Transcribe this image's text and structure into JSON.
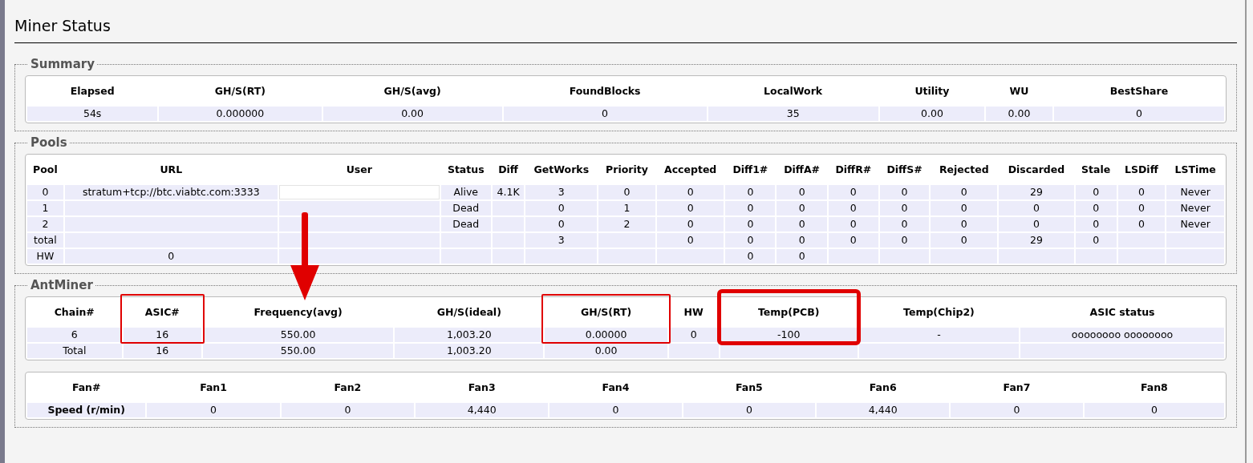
{
  "page": {
    "title": "Miner Status"
  },
  "sections": [
    {
      "legend": "Summary",
      "tables": [
        {
          "kind": "summary",
          "columns": [
            {
              "label": "Elapsed"
            },
            {
              "label": "GH/S(RT)"
            },
            {
              "label": "GH/S(avg)"
            },
            {
              "label": "FoundBlocks"
            },
            {
              "label": "LocalWork"
            },
            {
              "label": "Utility"
            },
            {
              "label": "WU"
            },
            {
              "label": "BestShare"
            }
          ],
          "rows": [
            {
              "cells": [
                "54s",
                "0.000000",
                "0.00",
                "0",
                "35",
                "0.00",
                "0.00",
                "0"
              ]
            }
          ]
        }
      ]
    },
    {
      "legend": "Pools",
      "tables": [
        {
          "kind": "pools",
          "columns": [
            {
              "label": "Pool"
            },
            {
              "label": "URL"
            },
            {
              "label": "User"
            },
            {
              "label": "Status"
            },
            {
              "label": "Diff"
            },
            {
              "label": "GetWorks"
            },
            {
              "label": "Priority"
            },
            {
              "label": "Accepted"
            },
            {
              "label": "Diff1#"
            },
            {
              "label": "DiffA#"
            },
            {
              "label": "DiffR#"
            },
            {
              "label": "DiffS#"
            },
            {
              "label": "Rejected"
            },
            {
              "label": "Discarded"
            },
            {
              "label": "Stale"
            },
            {
              "label": "LSDiff"
            },
            {
              "label": "LSTime"
            }
          ],
          "rows": [
            {
              "cells": [
                "0",
                "stratum+tcp://btc.viabtc.com:3333",
                {
                  "kind": "redacted"
                },
                "Alive",
                "4.1K",
                "3",
                "0",
                "0",
                "0",
                "0",
                "0",
                "0",
                "0",
                "29",
                "0",
                "0",
                "Never"
              ]
            },
            {
              "cells": [
                "1",
                null,
                null,
                "Dead",
                null,
                "0",
                "1",
                "0",
                "0",
                "0",
                "0",
                "0",
                "0",
                "0",
                "0",
                "0",
                "Never"
              ]
            },
            {
              "cells": [
                "2",
                null,
                null,
                "Dead",
                null,
                "0",
                "2",
                "0",
                "0",
                "0",
                "0",
                "0",
                "0",
                "0",
                "0",
                "0",
                "Never"
              ]
            },
            {
              "cells": [
                "total",
                null,
                null,
                null,
                null,
                "3",
                null,
                "0",
                "0",
                "0",
                "0",
                "0",
                "0",
                "29",
                "0",
                null,
                null
              ]
            },
            {
              "cells": [
                "HW",
                "0",
                null,
                null,
                null,
                null,
                null,
                null,
                "0",
                "0",
                null,
                null,
                null,
                null,
                null,
                null,
                null
              ]
            }
          ]
        }
      ]
    },
    {
      "legend": "AntMiner",
      "tables": [
        {
          "kind": "chains",
          "columns": [
            {
              "label": "Chain#",
              "boxed": false,
              "arrow": false
            },
            {
              "label": "ASIC#",
              "boxed": true,
              "thick": false,
              "arrow": false
            },
            {
              "label": "Frequency(avg)",
              "boxed": false,
              "arrow": true
            },
            {
              "label": "GH/S(ideal)",
              "boxed": false,
              "arrow": false
            },
            {
              "label": "GH/S(RT)",
              "boxed": true,
              "thick": false,
              "arrow": false
            },
            {
              "label": "HW",
              "boxed": false,
              "arrow": false
            },
            {
              "label": "Temp(PCB)",
              "boxed": true,
              "thick": true,
              "arrow": false
            },
            {
              "label": "Temp(Chip2)",
              "boxed": false,
              "arrow": false
            },
            {
              "label": "ASIC status",
              "boxed": false,
              "arrow": false
            }
          ],
          "rows": [
            {
              "cells": [
                "6",
                "16",
                "550.00",
                "1,003.20",
                "0.00000",
                "0",
                "-100",
                "-",
                "oooooooo oooooooo"
              ]
            },
            {
              "cells": [
                "Total",
                "16",
                "550.00",
                "1,003.20",
                "0.00",
                null,
                null,
                null,
                null
              ]
            }
          ]
        },
        {
          "kind": "fans",
          "columns": [
            {
              "label": "Fan#"
            },
            {
              "label": "Fan1"
            },
            {
              "label": "Fan2"
            },
            {
              "label": "Fan3"
            },
            {
              "label": "Fan4"
            },
            {
              "label": "Fan5"
            },
            {
              "label": "Fan6"
            },
            {
              "label": "Fan7"
            },
            {
              "label": "Fan8"
            }
          ],
          "rows": [
            {
              "cells": [
                {
                  "kind": "header",
                  "text": "Speed (r/min)"
                },
                "0",
                "0",
                "4,440",
                "0",
                "0",
                "4,440",
                "0",
                "0"
              ]
            }
          ]
        }
      ]
    }
  ]
}
